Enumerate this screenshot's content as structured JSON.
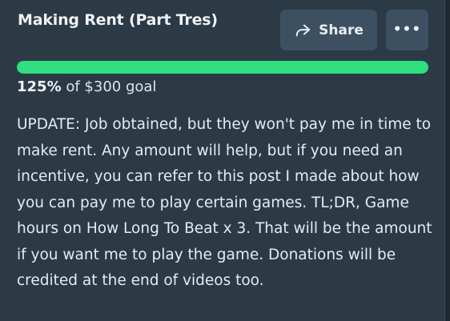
{
  "campaign": {
    "title": "Making Rent (Part Tres)",
    "share_label": "Share",
    "more_icon": "ellipsis-icon",
    "share_icon": "share-arrow-icon"
  },
  "progress": {
    "percent_label": "125%",
    "goal_text": "of $300 goal",
    "fill_fraction": 1.0,
    "bar_color": "#2fde7c",
    "track_color": "#3d5062"
  },
  "description": {
    "text": "UPDATE: Job obtained, but they won't pay me in time to make rent. Any amount will help, but if you need an incentive, you can refer to this post I made about how you can pay me to play certain games. TL;DR, Game hours on How Long To Beat x 3. That will be the amount if you want me to play the game. Donations will be credited at the end of videos too."
  },
  "colors": {
    "card_bg": "#2c3a46",
    "button_bg": "#3d5062",
    "text": "#e6ebef"
  }
}
